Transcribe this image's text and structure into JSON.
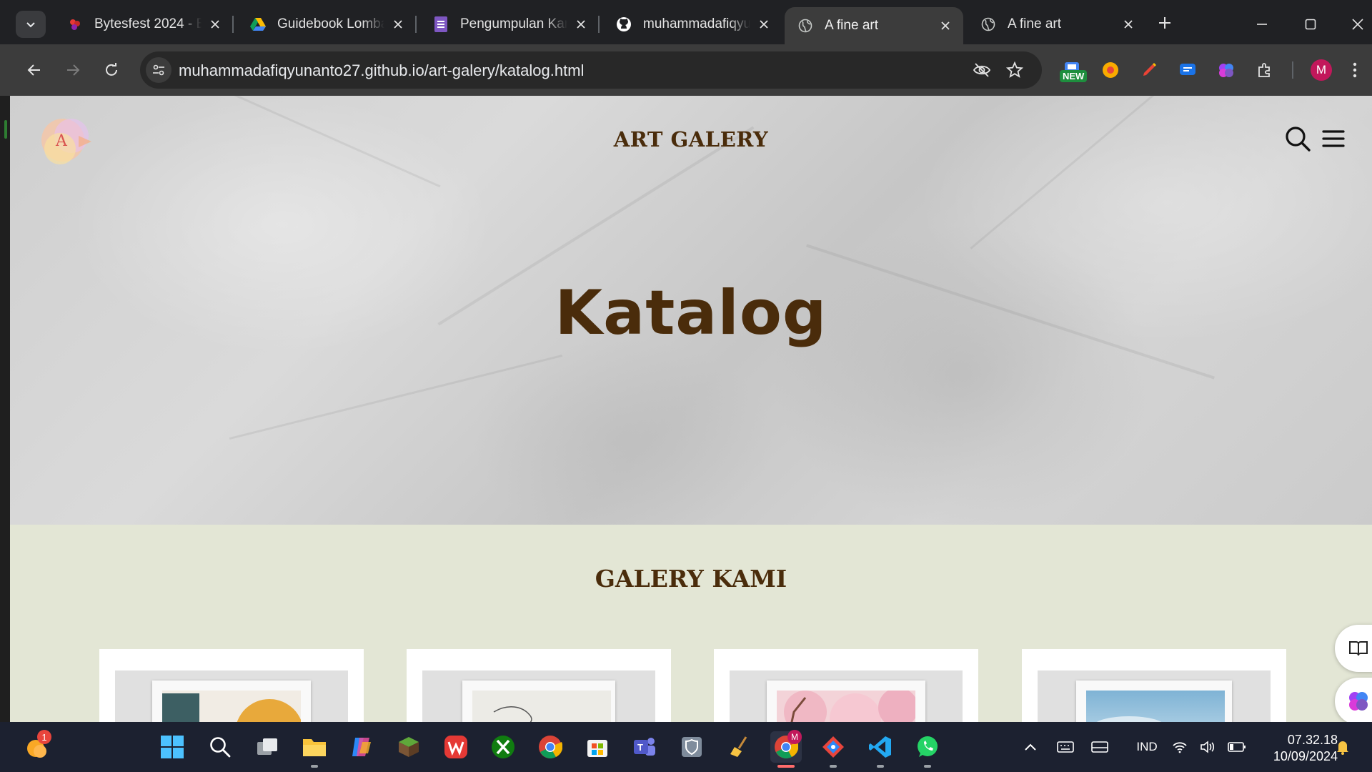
{
  "browser": {
    "tabs": [
      {
        "title": "Bytesfest 2024 - Bu",
        "active": false
      },
      {
        "title": "Guidebook Lomba",
        "active": false
      },
      {
        "title": "Pengumpulan Kary",
        "active": false
      },
      {
        "title": "muhammadafiqyun",
        "active": false
      },
      {
        "title": "A fine art",
        "active": true
      },
      {
        "title": "A fine art",
        "active": false
      }
    ],
    "url": "muhammadafiqyunanto27.github.io/art-galery/katalog.html",
    "extension_badge": "NEW",
    "profile_initial": "M"
  },
  "page": {
    "logo_letter": "A",
    "site_title": "ART GALERY",
    "hero_title": "Katalog",
    "gallery_title": "GALERY KAMI",
    "cards": [
      {
        "name": "abstract-shapes-artwork"
      },
      {
        "name": "line-drawing-artwork"
      },
      {
        "name": "cherry-blossom-artwork"
      },
      {
        "name": "sky-landscape-artwork"
      }
    ]
  },
  "taskbar": {
    "notification_count": "1",
    "language": "IND",
    "time": "07.32.18",
    "date": "10/09/2024",
    "chrome_badge": "M"
  },
  "colors": {
    "accent_brown": "#4a2c0b",
    "gallery_bg": "#e3e6d5",
    "browser_dark": "#202124"
  }
}
